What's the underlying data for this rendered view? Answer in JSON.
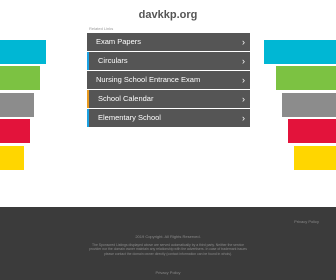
{
  "header": {
    "domain": "davkkp.org",
    "related_label": "Related Links"
  },
  "menu": {
    "items": [
      {
        "label": "Exam Papers",
        "chevron": "›"
      },
      {
        "label": "Circulars",
        "chevron": "›"
      },
      {
        "label": "Nursing School Entrance Exam",
        "chevron": "›"
      },
      {
        "label": "School Calendar",
        "chevron": "›"
      },
      {
        "label": "Elementary School",
        "chevron": "›"
      }
    ]
  },
  "colors": {
    "cyan": "#00b7d4",
    "green": "#7cc242",
    "gray": "#8c8c8c",
    "red": "#e3133b",
    "yellow": "#ffd600",
    "footer": "#3b3b3b",
    "menu": "#555555"
  },
  "footer": {
    "privacy": "Privacy Policy",
    "copyright": "2019 Copyright. All Rights Reserved.",
    "disclaimer": "The Sponsored Listings displayed above are served automatically by a third party. Neither the service provider nor the domain owner maintain any relationship with the advertisers. In case of trademark issues please contact the domain owner directly (contact information can be found in whois).",
    "link": "Privacy Policy"
  }
}
